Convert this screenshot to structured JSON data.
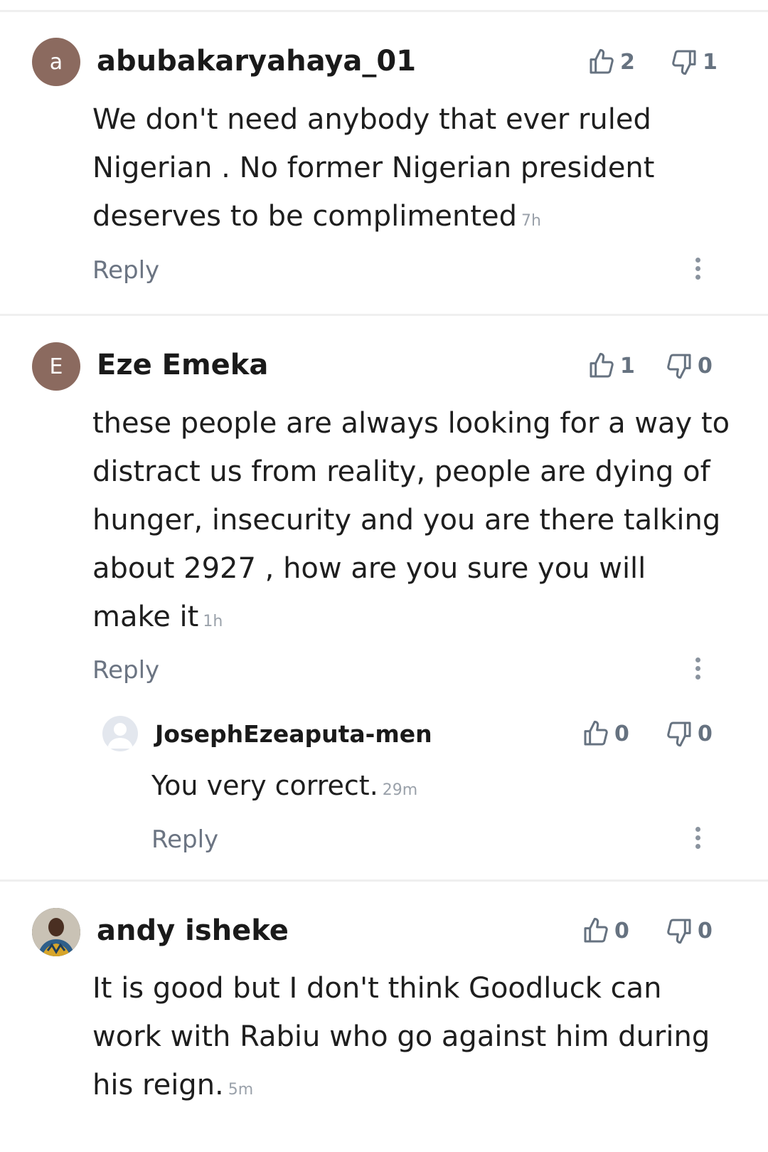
{
  "comments": [
    {
      "avatar_letter": "a",
      "avatar_color": "#8b6a5f",
      "username": "abubakaryahaya_01",
      "likes": "2",
      "dislikes": "1",
      "text": "We don't need anybody that ever ruled Nigerian . No former Nigerian president deserves to be complimented",
      "time": "7h",
      "reply_label": "Reply"
    },
    {
      "avatar_letter": "E",
      "avatar_color": "#8b6a5f",
      "username": "Eze Emeka",
      "likes": "1",
      "dislikes": "0",
      "text": "these people are always looking for a way to distract us from reality, people are dying of hunger, insecurity and you are there talking about 2927 , how are you sure you will make it",
      "time": "1h",
      "reply_label": "Reply",
      "replies": [
        {
          "username": "JosephEzeaputa-men",
          "likes": "0",
          "dislikes": "0",
          "text": "You very correct.",
          "time": "29m",
          "reply_label": "Reply"
        }
      ]
    },
    {
      "username": "andy isheke",
      "likes": "0",
      "dislikes": "0",
      "text": "It is good but I don't think Goodluck can work with Rabiu who go against him during his reign.",
      "time": "5m"
    }
  ]
}
